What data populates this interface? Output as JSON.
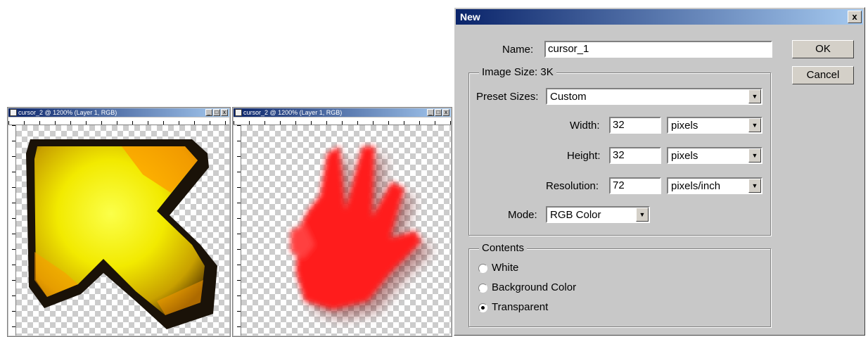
{
  "doc1": {
    "title": "cursor_2 @ 1200% (Layer 1, RGB)",
    "controls": [
      "_",
      "□",
      "x"
    ]
  },
  "doc2": {
    "title": "cursor_2 @ 1200% (Layer 1, RGB)",
    "controls": [
      "_",
      "□",
      "x"
    ]
  },
  "dialog": {
    "title": "New",
    "close": "x",
    "name_label": "Name:",
    "name_value": "cursor_1",
    "image_size_label": "Image Size: 3K",
    "preset_label": "Preset Sizes:",
    "preset_value": "Custom",
    "width_label": "Width:",
    "width_value": "32",
    "width_unit": "pixels",
    "height_label": "Height:",
    "height_value": "32",
    "height_unit": "pixels",
    "resolution_label": "Resolution:",
    "resolution_value": "72",
    "resolution_unit": "pixels/inch",
    "mode_label": "Mode:",
    "mode_value": "RGB Color",
    "ok": "OK",
    "cancel": "Cancel",
    "contents_label": "Contents",
    "contents_options": [
      "White",
      "Background Color",
      "Transparent"
    ],
    "contents_selected": "Transparent"
  },
  "colors": {
    "titlebar_start": "#0a246a",
    "titlebar_end": "#a6caf0",
    "dialog_bg": "#c8c8c8",
    "arrow_fill": "#f4f000",
    "hand_fill": "#ff1a1a"
  }
}
